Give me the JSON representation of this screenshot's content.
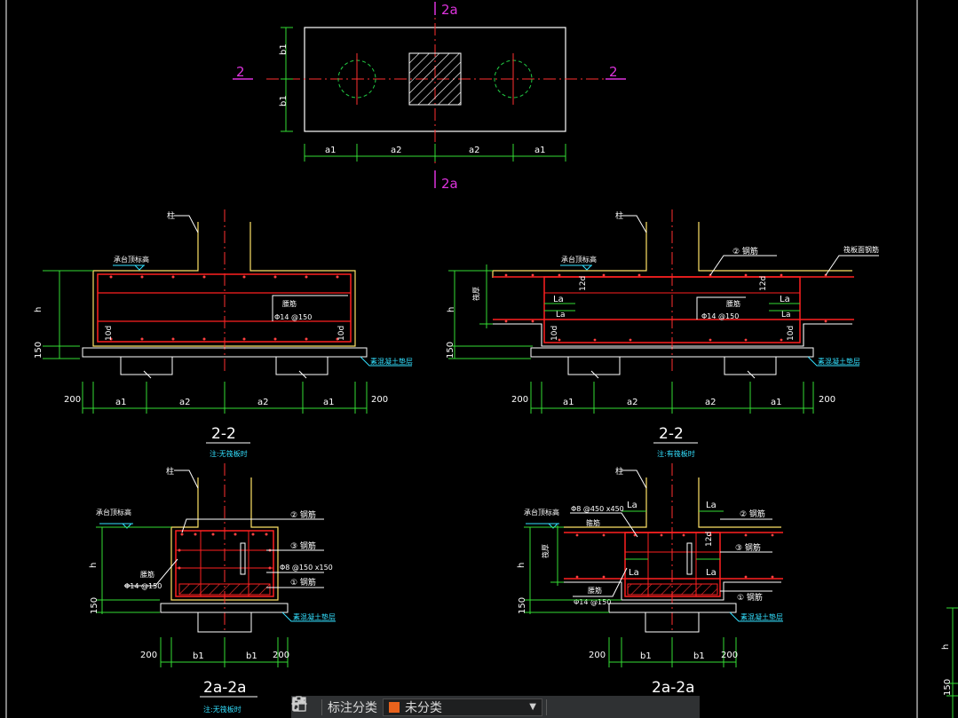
{
  "colors": {
    "bg": "#000000",
    "outline": "#ffffff",
    "rebar": "#ff2020",
    "centerline": "#ff3030",
    "dimension": "#33dd33",
    "section_mark": "#dd33dd",
    "note": "#33e0ff",
    "pile": "#22cc44",
    "leader": "#ffffff",
    "toolbar_swatch": "#e8621c"
  },
  "plan": {
    "section_top": "2a",
    "section_bottom": "2a",
    "section_left": "2",
    "section_right": "2",
    "dim_bottom": [
      "a1",
      "a2",
      "a2",
      "a1"
    ],
    "dim_left": [
      "b1",
      "b1"
    ]
  },
  "sec_left": {
    "title": "2-2",
    "note": "注:无筏板时",
    "column_label": "柱",
    "top_label": "承台顶标高",
    "stirrup_label": "腰筋",
    "stirrup_spec": "Φ14 @150",
    "hook_left": "10d",
    "hook_right": "10d",
    "cushion_note": "素混凝土垫层",
    "dim_h": "h",
    "dim_150": "150",
    "dim_bottom": [
      "200",
      "a1",
      "a2",
      "a2",
      "a1",
      "200"
    ]
  },
  "sec_right": {
    "title": "2-2",
    "note": "注:有筏板时",
    "column_label": "柱",
    "top_label": "承台顶标高",
    "rebar2_label": "② 钢筋",
    "raft_label": "筏板面钢筋",
    "raft_thick": "筏厚",
    "la1": "La",
    "la2": "La",
    "la3": "La",
    "la4": "La",
    "d12_left": "12d",
    "d12_right": "12d",
    "stirrup_label": "腰筋",
    "stirrup_spec": "Φ14 @150",
    "hook_left": "10d",
    "hook_right": "10d",
    "cushion_note": "素混凝土垫层",
    "dim_h": "h",
    "dim_150": "150",
    "dim_bottom": [
      "200",
      "a1",
      "a2",
      "a2",
      "a1",
      "200"
    ]
  },
  "sec_bl": {
    "title": "2a-2a",
    "note": "注:无筏板时",
    "column_label": "柱",
    "top_label": "承台顶标高",
    "rebar2_label": "② 钢筋",
    "rebar3_label": "③ 钢筋",
    "rebar1_label": "① 钢筋",
    "stirrup_spec2": "Φ8 @150 x150",
    "stirrup_label": "腰筋",
    "stirrup_spec": "Φ14 @150",
    "cushion_note": "素混凝土垫层",
    "dim_h": "h",
    "dim_150": "150",
    "dim_bottom": [
      "200",
      "b1",
      "b1",
      "200"
    ]
  },
  "sec_br": {
    "title": "2a-2a",
    "column_label": "柱",
    "top_label": "承台顶标高",
    "stirrup_spec2": "Φ8 @450 x450",
    "la1": "La",
    "la2": "La",
    "la3": "La",
    "la4": "La",
    "d12": "12d",
    "rebar2_label": "② 钢筋",
    "rebar3_label": "③ 钢筋",
    "rebar1_label": "① 钢筋",
    "raft_label": "箍筋",
    "raft_thick": "筏厚",
    "stirrup_label": "腰筋",
    "stirrup_spec": "Φ14 @150",
    "cushion_note": "素混凝土垫层",
    "dim_h": "h",
    "dim_150": "150",
    "dim_bottom": [
      "200",
      "b1",
      "b1",
      "200"
    ]
  },
  "edge_right": {
    "dim_h": "h",
    "dim_150": "150"
  },
  "toolbar": {
    "label": "标注分类",
    "selected": "未分类",
    "icons": [
      "group-icon",
      "edit-icon",
      "move-icon",
      "copy-icon",
      "paste-icon"
    ]
  }
}
